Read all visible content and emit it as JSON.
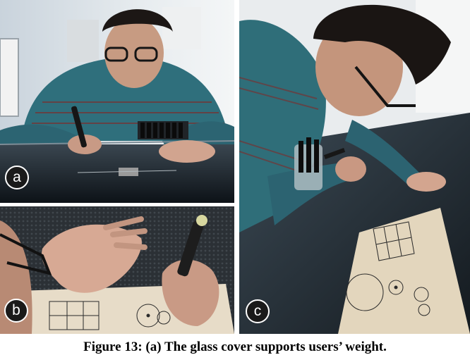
{
  "figure": {
    "panels": [
      {
        "label": "a"
      },
      {
        "label": "b"
      },
      {
        "label": "c"
      }
    ],
    "caption": "Figure 13: (a) The glass cover supports users’ weight."
  }
}
